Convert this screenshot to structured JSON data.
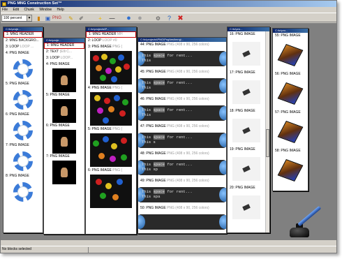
{
  "app": {
    "title": "PNG MNG Construction Set™"
  },
  "menu": [
    "File",
    "Edit",
    "Chunk",
    "Window",
    "Help"
  ],
  "toolbar": {
    "zoom_value": "100 percent"
  },
  "windows": {
    "w1": {
      "title": "C:\\tc\\proje...",
      "rows": [
        {
          "label": "1: MNG HEADER",
          "extra": "",
          "selected": true
        },
        {
          "label": "2: MNG BACKGRO...",
          "extra": "",
          "selected": false
        },
        {
          "label": "3: LOOP",
          "extra": "LOOP ...",
          "selected": false
        },
        {
          "label": "4: PNG IMAGE",
          "extra": "",
          "selected": false
        }
      ],
      "images": [
        "5: PNG IMAGE",
        "6: PNG IMAGE",
        "7: PNG IMAGE",
        "8: PNG IMAGE"
      ]
    },
    "w2": {
      "title": "C:\\tc\\proje...",
      "rows": [
        {
          "label": "1: MNG HEADER",
          "extra": "",
          "selected": true
        },
        {
          "label": "2: TEXT",
          "extra": "(Elli C...",
          "selected": false
        },
        {
          "label": "3: LOOP",
          "extra": "LOOP...",
          "selected": false
        },
        {
          "label": "4: PNG IMAGE",
          "extra": "",
          "selected": false
        }
      ],
      "images": [
        "5: PNG IMAGE",
        "6: PNG IMAGE",
        "7: PNG IMAGE"
      ]
    },
    "w3": {
      "title": "C:\\tc\\projects\\P...",
      "rows": [
        {
          "label": "1: MNG HEADER",
          "extra": "MH",
          "selected": true
        },
        {
          "label": "2: LOOP",
          "extra": "LOOP #0",
          "selected": false
        },
        {
          "label": "3: PNG IMAGE",
          "extra": "PNG (",
          "selected": false
        }
      ],
      "images": [
        "4: PNG IMAGE",
        "5: PNG IMAGE",
        "6: PNG IMAGE"
      ],
      "image_extra": "PNG ("
    },
    "w4": {
      "title": "C:\\tc\\projects\\PNG\\Png\\test\\mng\\...",
      "items": [
        {
          "label": "44: PNG IMAGE",
          "info": "PNG (408 x 90, 256 colors)",
          "line1": "This ",
          "line1_hl": "space",
          "line1_rest": " for rent...",
          "line2": "This "
        },
        {
          "label": "45: PNG IMAGE",
          "info": "PNG (408 x 90, 256 colors)",
          "line1": "This ",
          "line1_hl": "space",
          "line1_rest": " for rent...",
          "line2": "This"
        },
        {
          "label": "46: PNG IMAGE",
          "info": "PNG (408 x 90, 256 colors)",
          "line1": "This ",
          "line1_hl": "space",
          "line1_rest": " for rent...",
          "line2": "This "
        },
        {
          "label": "47: PNG IMAGE",
          "info": "PNG (408 x 90, 256 colors)",
          "line1": "This ",
          "line1_hl": "space",
          "line1_rest": " for rent...",
          "line2": "This s"
        },
        {
          "label": "48: PNG IMAGE",
          "info": "PNG (408 x 90, 256 colors)",
          "line1": "This ",
          "line1_hl": "space",
          "line1_rest": " for rent...",
          "line2": "This sp"
        },
        {
          "label": "49: PNG IMAGE",
          "info": "PNG (408 x 90, 256 colors)",
          "line1": "This ",
          "line1_hl": "space",
          "line1_rest": " for rent...",
          "line2": "This spa"
        },
        {
          "label": "50: PNG IMAGE",
          "info": "PNG (408 x 90, 256 colors)",
          "line1": "",
          "line1_hl": "",
          "line1_rest": "",
          "line2": ""
        }
      ]
    },
    "w5": {
      "title": "C:\\tc\\pro...",
      "items": [
        "16: PNG IMAGE",
        "17: PNG IMAGE",
        "18: PNG IMAGE",
        "19: PNG IMAGE",
        "20: PNG IMAGE"
      ]
    },
    "w6": {
      "title": "C:\\tc\\pro...",
      "items": [
        "55: PNG IMAGE",
        "56: PNG IMAGE",
        "57: PNG IMAGE",
        "58: PNG IMAGE"
      ]
    }
  },
  "status": {
    "text": "No blocks selected"
  }
}
